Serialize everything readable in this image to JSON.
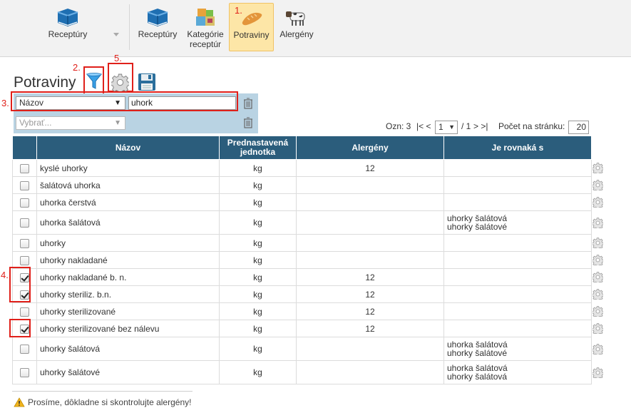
{
  "toolbar": {
    "items": [
      {
        "label": "Receptúry",
        "icon": "book-icon"
      },
      {
        "label": "Receptúry",
        "icon": "book-icon"
      },
      {
        "label": "Kategórie\nreceptúr",
        "icon": "boxes-icon"
      },
      {
        "label": "Potraviny",
        "icon": "bread-icon",
        "active": true
      },
      {
        "label": "Alergény",
        "icon": "cow-icon"
      }
    ]
  },
  "annotations": [
    "1.",
    "2.",
    "3.",
    "4.",
    "5."
  ],
  "page": {
    "title": "Potraviny"
  },
  "filter": {
    "field_select": "Názov",
    "search_value": "uhork",
    "second_select_placeholder": "Vybrať..."
  },
  "pagination": {
    "marked_label": "Ozn: 3",
    "first_prev": "|< <",
    "current_page": "1",
    "of_total": "/ 1",
    "next_last": "> >|",
    "per_page_label": "Počet na stránku:",
    "per_page_value": "20"
  },
  "table": {
    "headers": [
      "Názov",
      "Prednastavená\njednotka",
      "Alergény",
      "Je rovnaká s"
    ],
    "rows": [
      {
        "checked": false,
        "name": "kyslé uhorky",
        "unit": "kg",
        "allergens": "12",
        "same_as": []
      },
      {
        "checked": false,
        "name": "šalátová uhorka",
        "unit": "kg",
        "allergens": "",
        "same_as": []
      },
      {
        "checked": false,
        "name": "uhorka čerstvá",
        "unit": "kg",
        "allergens": "",
        "same_as": []
      },
      {
        "checked": false,
        "name": "uhorka šalátová",
        "unit": "kg",
        "allergens": "",
        "same_as": [
          "uhorky šalátová",
          "uhorky šalátové"
        ]
      },
      {
        "checked": false,
        "name": "uhorky",
        "unit": "kg",
        "allergens": "",
        "same_as": []
      },
      {
        "checked": false,
        "name": "uhorky nakladané",
        "unit": "kg",
        "allergens": "",
        "same_as": []
      },
      {
        "checked": true,
        "name": "uhorky nakladané b. n.",
        "unit": "kg",
        "allergens": "12",
        "same_as": []
      },
      {
        "checked": true,
        "name": "uhorky steriliz. b.n.",
        "unit": "kg",
        "allergens": "12",
        "same_as": []
      },
      {
        "checked": false,
        "name": "uhorky sterilizované",
        "unit": "kg",
        "allergens": "12",
        "same_as": []
      },
      {
        "checked": true,
        "name": "uhorky sterilizované bez nálevu",
        "unit": "kg",
        "allergens": "12",
        "same_as": []
      },
      {
        "checked": false,
        "name": "uhorky šalátová",
        "unit": "kg",
        "allergens": "",
        "same_as": [
          "uhorka šalátová",
          "uhorky šalátové"
        ]
      },
      {
        "checked": false,
        "name": "uhorky šalátové",
        "unit": "kg",
        "allergens": "",
        "same_as": [
          "uhorka šalátová",
          "uhorky šalátová"
        ]
      }
    ]
  },
  "footer": {
    "warning": "Prosíme, dôkladne si skontrolujte alergény!"
  },
  "colors": {
    "header_bg": "#2b5d7c",
    "filter_bg": "#b9d3e3",
    "active_tab": "#fde6a7",
    "annotation": "#e0201a"
  }
}
